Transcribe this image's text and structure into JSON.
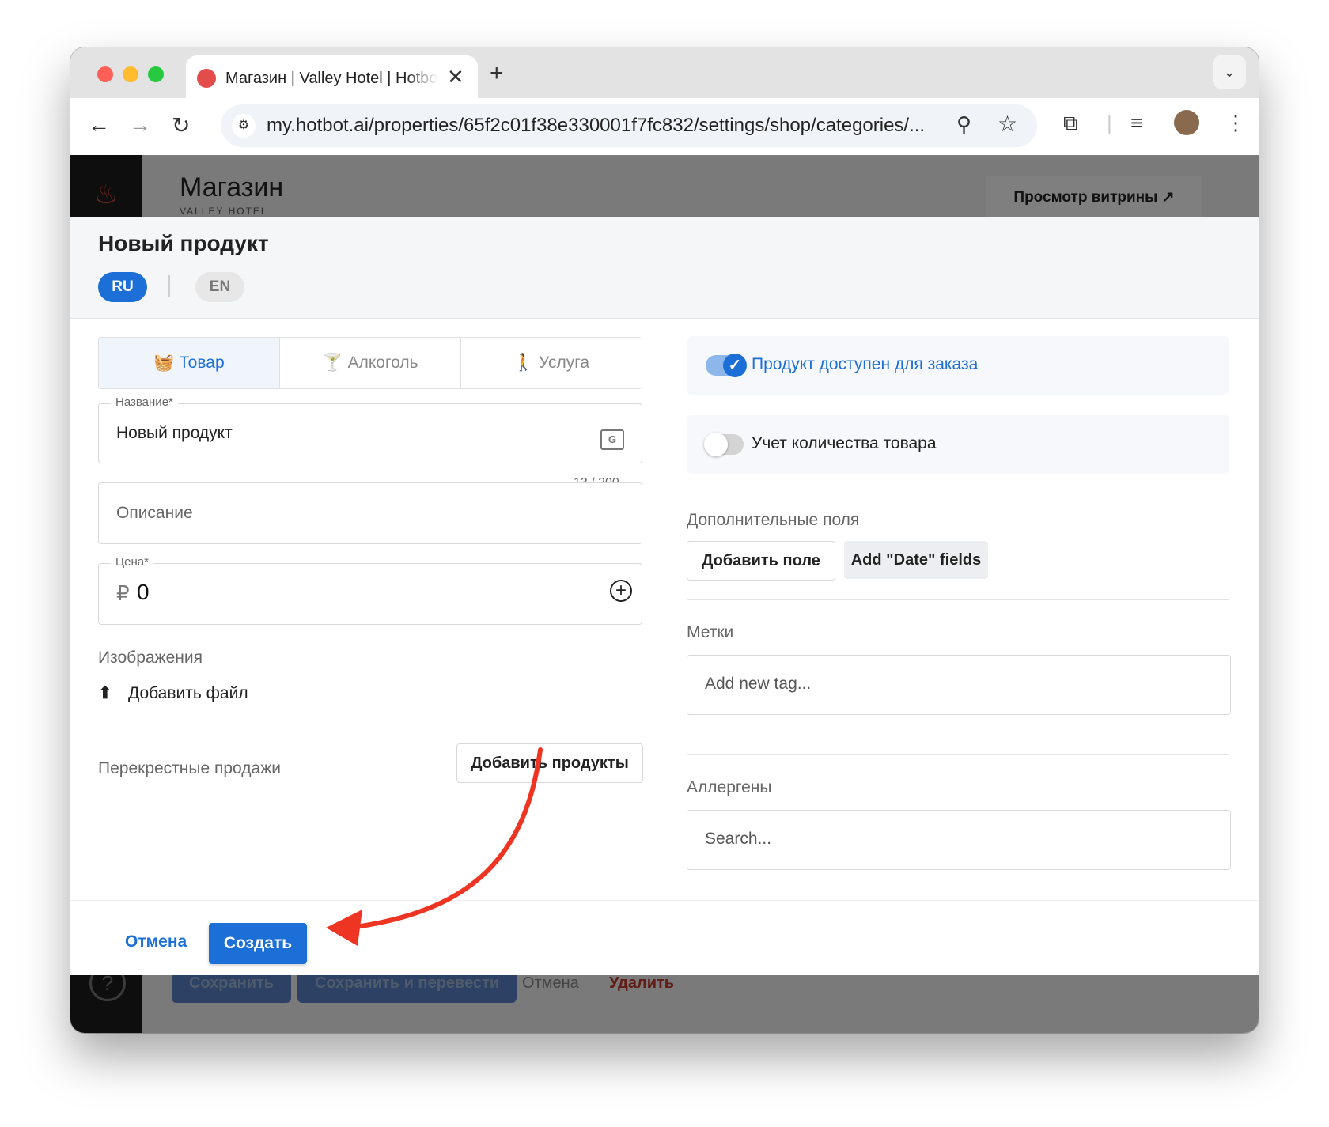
{
  "browser": {
    "tab_title": "Магазин | Valley Hotel | Hotbot",
    "url": "my.hotbot.ai/properties/65f2c01f38e330001f7fc832/settings/shop/categories/..."
  },
  "page": {
    "title": "Магазин",
    "subtitle": "VALLEY HOTEL",
    "preview_button": "Просмотр витрины ↗",
    "bottom_bar": {
      "save": "Сохранить",
      "save_translate": "Сохранить и перевести",
      "cancel": "Отмена",
      "delete": "Удалить"
    }
  },
  "modal": {
    "title": "Новый продукт",
    "languages": [
      "RU",
      "EN"
    ],
    "type_tabs": [
      {
        "label": "Товар",
        "icon": "basket-icon",
        "active": true
      },
      {
        "label": "Алкоголь",
        "icon": "cocktail-glass-icon",
        "active": false
      },
      {
        "label": "Услуга",
        "icon": "person-service-icon",
        "active": false
      }
    ],
    "name_field": {
      "label": "Название*",
      "value": "Новый продукт",
      "counter": "13 / 200"
    },
    "description_field": {
      "placeholder": "Описание"
    },
    "price_field": {
      "label": "Цена*",
      "currency": "₽",
      "value": "0"
    },
    "images": {
      "label": "Изображения",
      "upload": "Добавить файл"
    },
    "cross_sales": {
      "label": "Перекрестные продажи",
      "button": "Добавить продукты"
    },
    "available_toggle": {
      "label": "Продукт доступен для заказа",
      "on": true
    },
    "quantity_toggle": {
      "label": "Учет количества товара",
      "on": false
    },
    "extra_fields": {
      "label": "Дополнительные поля",
      "add_field": "Добавить поле",
      "add_date": "Add \"Date\" fields"
    },
    "tags": {
      "label": "Метки",
      "placeholder": "Add new tag..."
    },
    "allergens": {
      "label": "Аллергены",
      "placeholder": "Search..."
    },
    "footer": {
      "cancel": "Отмена",
      "create": "Создать"
    }
  },
  "colors": {
    "accent": "#1b6fd6",
    "annotation_arrow": "#ee3524",
    "danger": "#c0392b"
  }
}
